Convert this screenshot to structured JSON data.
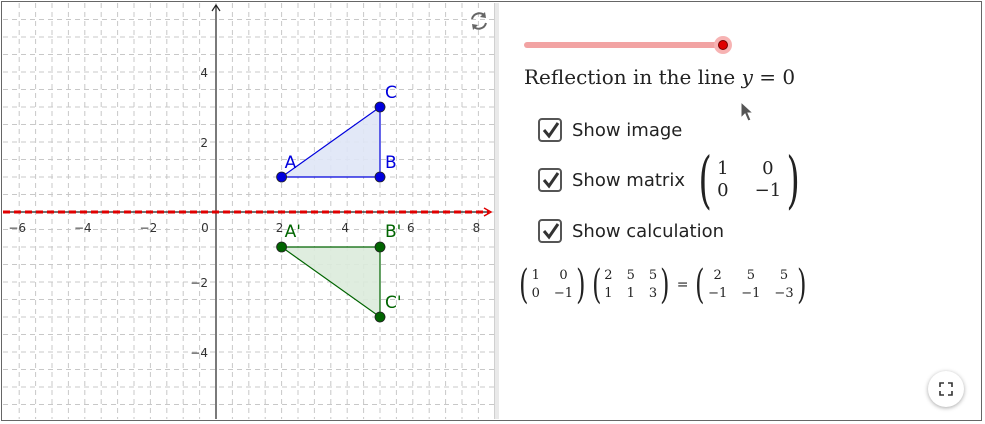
{
  "graph": {
    "x_ticks": [
      "−6",
      "−4",
      "−2",
      "0",
      "2",
      "4",
      "6",
      "8"
    ],
    "y_ticks_pos": [
      "4",
      "2"
    ],
    "y_ticks_neg": [
      "−2",
      "−4"
    ],
    "points_original": [
      {
        "label": "A",
        "x": 2,
        "y": 1
      },
      {
        "label": "B",
        "x": 5,
        "y": 1
      },
      {
        "label": "C",
        "x": 5,
        "y": 3
      }
    ],
    "points_image": [
      {
        "label": "A'",
        "x": 2,
        "y": -1
      },
      {
        "label": "B'",
        "x": 5,
        "y": -1
      },
      {
        "label": "C'",
        "x": 5,
        "y": -3
      }
    ],
    "colors": {
      "original": "#0000dd",
      "original_fill": "#dfe6f6",
      "image": "#006400",
      "image_fill": "#dcebdc",
      "mirror_line": "#e00000"
    },
    "refresh_icon": "refresh-icon"
  },
  "panel": {
    "slider_value": 1,
    "caption_text": "Reflection in the line ",
    "caption_var": "y",
    "caption_rest": " = 0",
    "checkbox_image_label": "Show image",
    "checkbox_matrix_label": "Show matrix",
    "checkbox_calc_label": "Show calculation",
    "checkbox_image_checked": true,
    "checkbox_matrix_checked": true,
    "checkbox_calc_checked": true,
    "matrix": [
      [
        "1",
        "0"
      ],
      [
        "0",
        "−1"
      ]
    ],
    "calc_left": [
      [
        "1",
        "0"
      ],
      [
        "0",
        "−1"
      ]
    ],
    "calc_mid": [
      [
        "2",
        "5",
        "5"
      ],
      [
        "1",
        "1",
        "3"
      ]
    ],
    "calc_eq": "=",
    "calc_right": [
      [
        "2",
        "5",
        "5"
      ],
      [
        "−1",
        "−1",
        "−3"
      ]
    ],
    "fullscreen_icon": "fullscreen-icon"
  }
}
